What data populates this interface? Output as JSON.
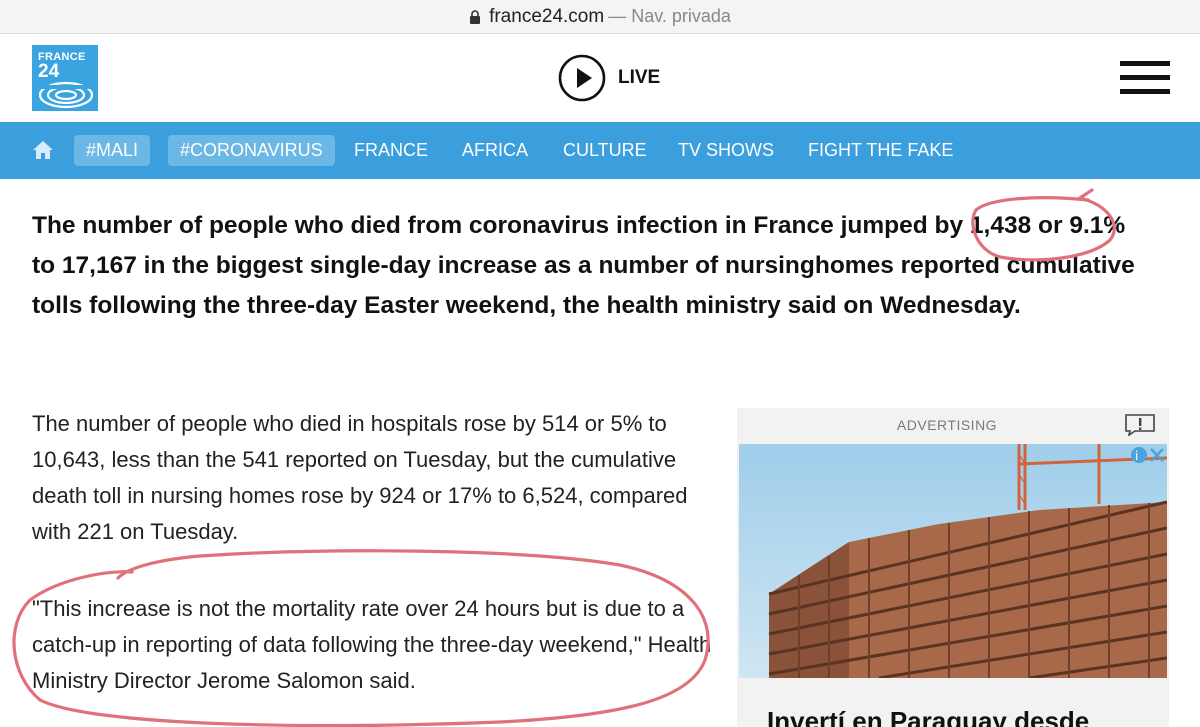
{
  "browser": {
    "domain": "france24.com",
    "mode": "— Nav. privada"
  },
  "header": {
    "logo_line1": "FRANCE",
    "logo_line2": "24",
    "live_label": "LIVE"
  },
  "nav": {
    "tags": [
      "#MALI",
      "#CORONAVIRUS"
    ],
    "items": [
      "FRANCE",
      "AFRICA",
      "CULTURE",
      "TV SHOWS",
      "FIGHT THE FAKE"
    ]
  },
  "article": {
    "lead": "The number of people who died from coronavirus infection in France jumped by 1,438 or 9.1% to 17,167 in the biggest single-day increase as a number of nursinghomes reported cumulative tolls following the three-day Easter weekend, the health ministry said on Wednesday.",
    "para1": "The number of people who died in hospitals rose by 514 or 5% to 10,643, less than the 541 reported on Tuesday, but the cumulative death toll in nursing homes rose by 924 or 17% to 6,524, compared with 221 on Tuesday.",
    "para2": "\"This increase is not the mortality rate over 24 hours but is due to a catch-up in reporting of data following the three-day weekend,\" Health Ministry Director Jerome Salomon said."
  },
  "ad": {
    "label": "ADVERTISING",
    "headline": "Invertí en Paraguay desde"
  },
  "colors": {
    "nav_bg": "#3a9fdc",
    "logo_bg": "#3aa4e0",
    "annotation": "#e0707a"
  }
}
